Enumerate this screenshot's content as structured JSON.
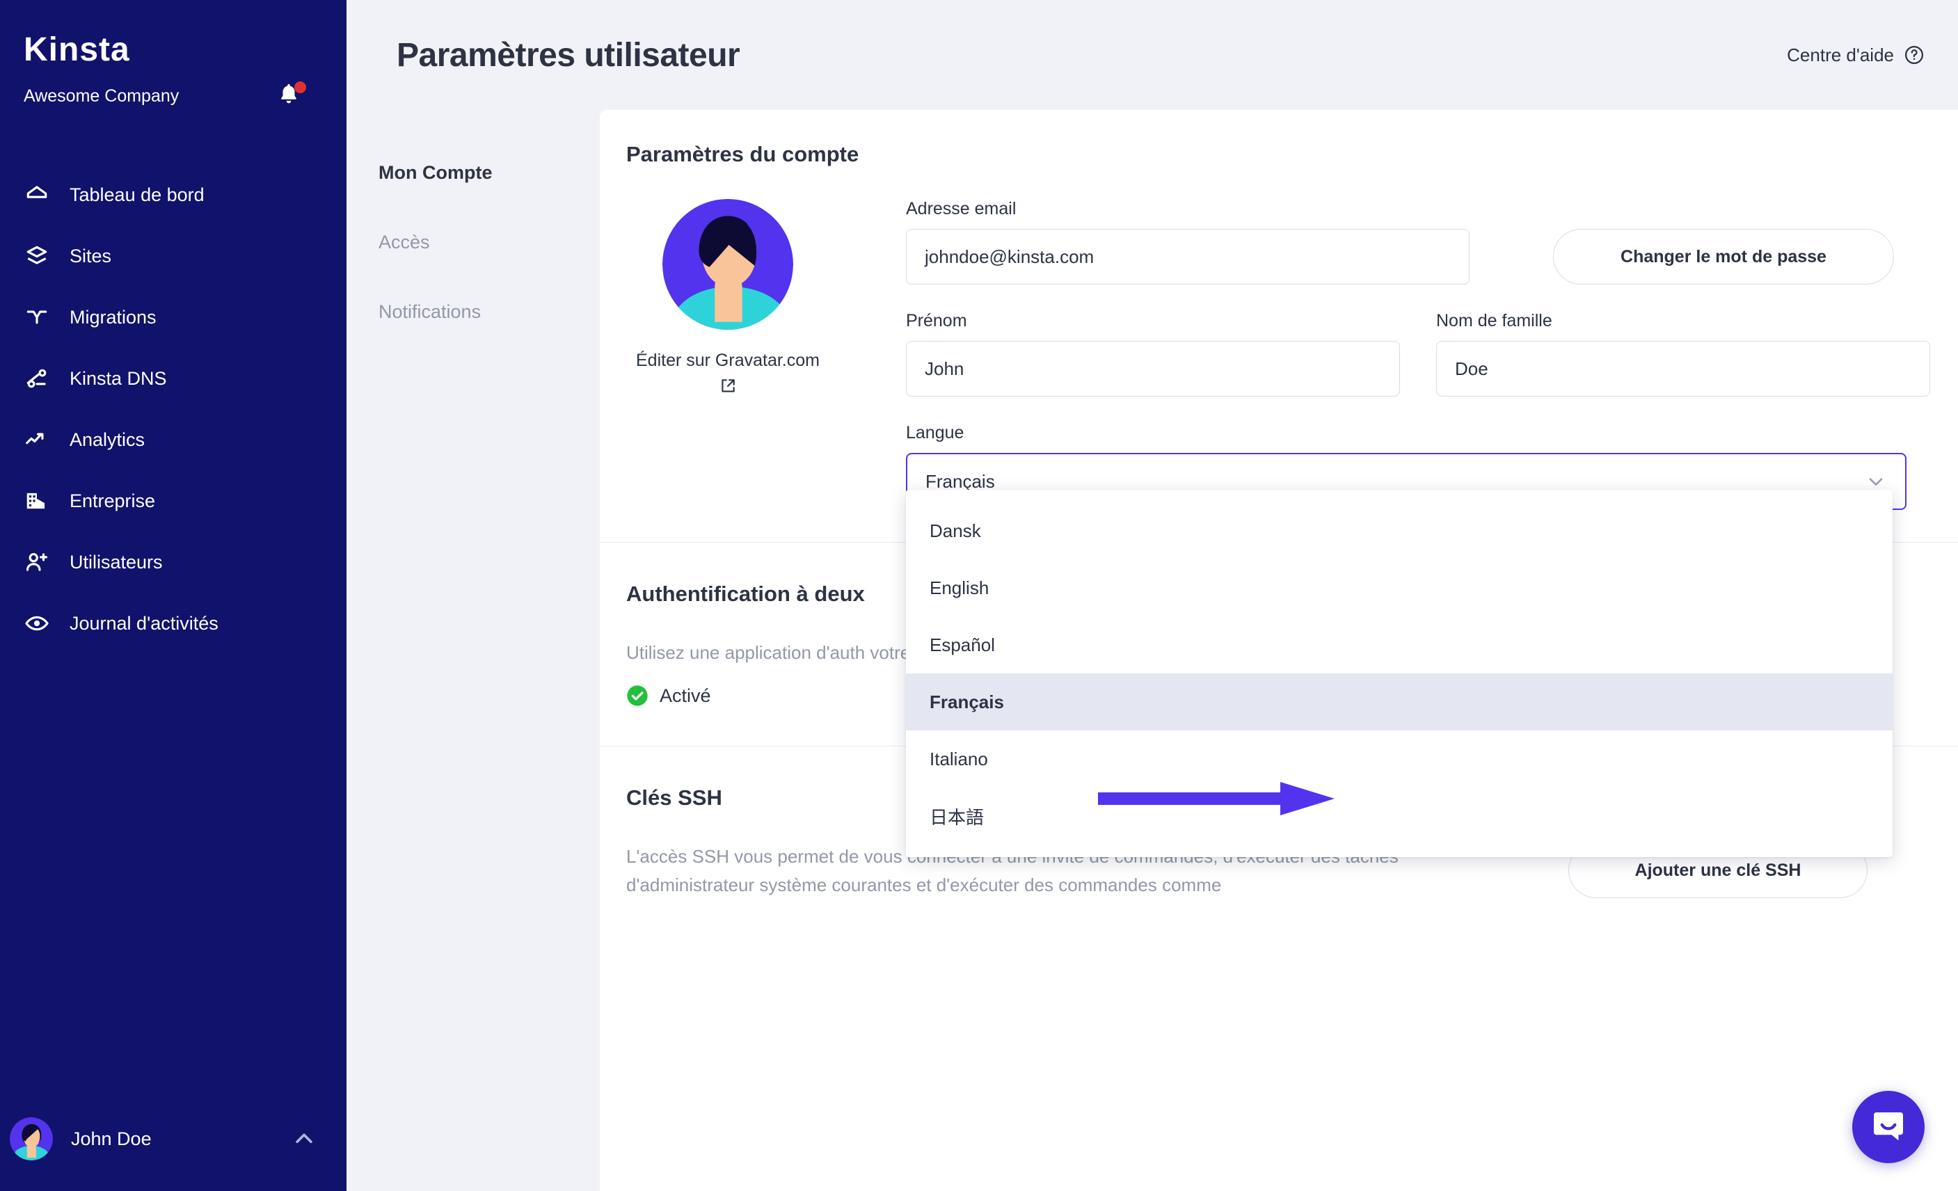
{
  "sidebar": {
    "logo": "Kinsta",
    "company": "Awesome Company",
    "bell_icon": "bell-icon",
    "items": [
      {
        "label": "Tableau de bord",
        "icon": "home-icon"
      },
      {
        "label": "Sites",
        "icon": "layers-icon"
      },
      {
        "label": "Migrations",
        "icon": "merge-icon"
      },
      {
        "label": "Kinsta DNS",
        "icon": "dns-nodes-icon"
      },
      {
        "label": "Analytics",
        "icon": "trending-up-icon"
      },
      {
        "label": "Entreprise",
        "icon": "building-icon"
      },
      {
        "label": "Utilisateurs",
        "icon": "user-plus-icon"
      },
      {
        "label": "Journal d'activités",
        "icon": "eye-icon"
      }
    ],
    "user": {
      "name": "John Doe",
      "chevron_icon": "chevron-up-icon"
    }
  },
  "header": {
    "title": "Paramètres utilisateur",
    "help_label": "Centre d'aide",
    "help_icon": "question-circle-icon"
  },
  "subnav": {
    "items": [
      {
        "label": "Mon Compte",
        "active": true
      },
      {
        "label": "Accès",
        "active": false
      },
      {
        "label": "Notifications",
        "active": false
      }
    ]
  },
  "account": {
    "section_title": "Paramètres du compte",
    "avatar_alt": "avatar",
    "gravatar_link": "Éditer sur Gravatar.com",
    "gravatar_icon": "external-link-icon",
    "email_label": "Adresse email",
    "email_value": "johndoe@kinsta.com",
    "change_password_label": "Changer le mot de passe",
    "firstname_label": "Prénom",
    "firstname_value": "John",
    "lastname_label": "Nom de famille",
    "lastname_value": "Doe",
    "language_label": "Langue",
    "language_value": "Français",
    "language_chevron_icon": "chevron-down-icon",
    "language_options": [
      {
        "label": "Dansk",
        "selected": false
      },
      {
        "label": "English",
        "selected": false
      },
      {
        "label": "Español",
        "selected": false
      },
      {
        "label": "Français",
        "selected": true
      },
      {
        "label": "Italiano",
        "selected": false
      },
      {
        "label": "日本語",
        "selected": false
      }
    ]
  },
  "twofactor": {
    "section_title": "Authentification à deux",
    "description": "Utilisez une application d'auth votre téléphone pour générer",
    "status_icon": "check-circle-icon",
    "status_text": "Activé",
    "status_color": "#22c03c"
  },
  "ssh": {
    "section_title": "Clés SSH",
    "description": "L'accès SSH vous permet de vous connecter à une invite de commandes, d'exécuter des tâches d'administrateur système courantes et d'exécuter des commandes comme",
    "add_key_label": "Ajouter une clé SSH"
  },
  "annotation": {
    "arrow_color": "#5333ed",
    "arrow_icon": "right-arrow-annotation"
  },
  "intercom": {
    "icon": "chat-bubble-icon",
    "color": "#4329d8"
  },
  "colors": {
    "sidebar_bg": "#11126b",
    "page_bg": "#f1f2f7",
    "accent": "#5333ed",
    "text": "#2d3343",
    "muted": "#9298a8"
  }
}
